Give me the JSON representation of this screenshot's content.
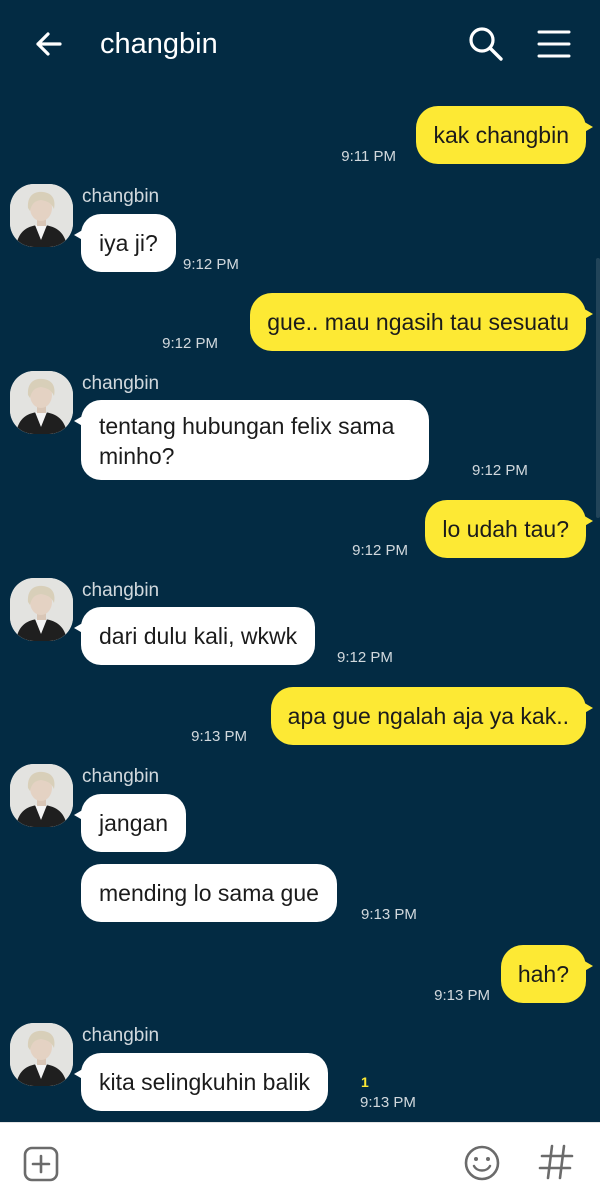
{
  "header": {
    "title": "changbin",
    "back_icon": "arrow-left-icon",
    "search_icon": "search-icon",
    "menu_icon": "hamburger-menu-icon"
  },
  "contact": {
    "name": "changbin"
  },
  "messages": [
    {
      "from": "me",
      "text": "kak changbin",
      "time": "9:11 PM"
    },
    {
      "from": "changbin",
      "text": "iya ji?",
      "time": "9:12 PM"
    },
    {
      "from": "me",
      "text": "gue.. mau ngasih tau sesuatu",
      "time": "9:12 PM"
    },
    {
      "from": "changbin",
      "line1": "tentang hubungan felix sama",
      "line2": "minho?",
      "time": "9:12 PM"
    },
    {
      "from": "me",
      "text": "lo udah tau?",
      "time": "9:12 PM"
    },
    {
      "from": "changbin",
      "text": "dari dulu kali, wkwk",
      "time": "9:12 PM"
    },
    {
      "from": "me",
      "text": "apa gue ngalah aja ya kak..",
      "time": "9:13 PM"
    },
    {
      "from": "changbin",
      "text": "jangan",
      "time": ""
    },
    {
      "from": "changbin",
      "text": "mending lo sama gue",
      "time": "9:13 PM"
    },
    {
      "from": "me",
      "text": "hah?",
      "time": "9:13 PM"
    },
    {
      "from": "changbin",
      "text": "kita selingkuhin balik",
      "time": "9:13 PM",
      "unread": "1"
    }
  ],
  "input_bar": {
    "placeholder": "",
    "add_icon": "plus-square-icon",
    "emoji_icon": "smiley-icon",
    "hash_icon": "hashtag-icon"
  },
  "colors": {
    "background": "#032b43",
    "outgoing_bubble": "#fde934",
    "incoming_bubble": "#ffffff",
    "input_bar": "#ffffff"
  }
}
